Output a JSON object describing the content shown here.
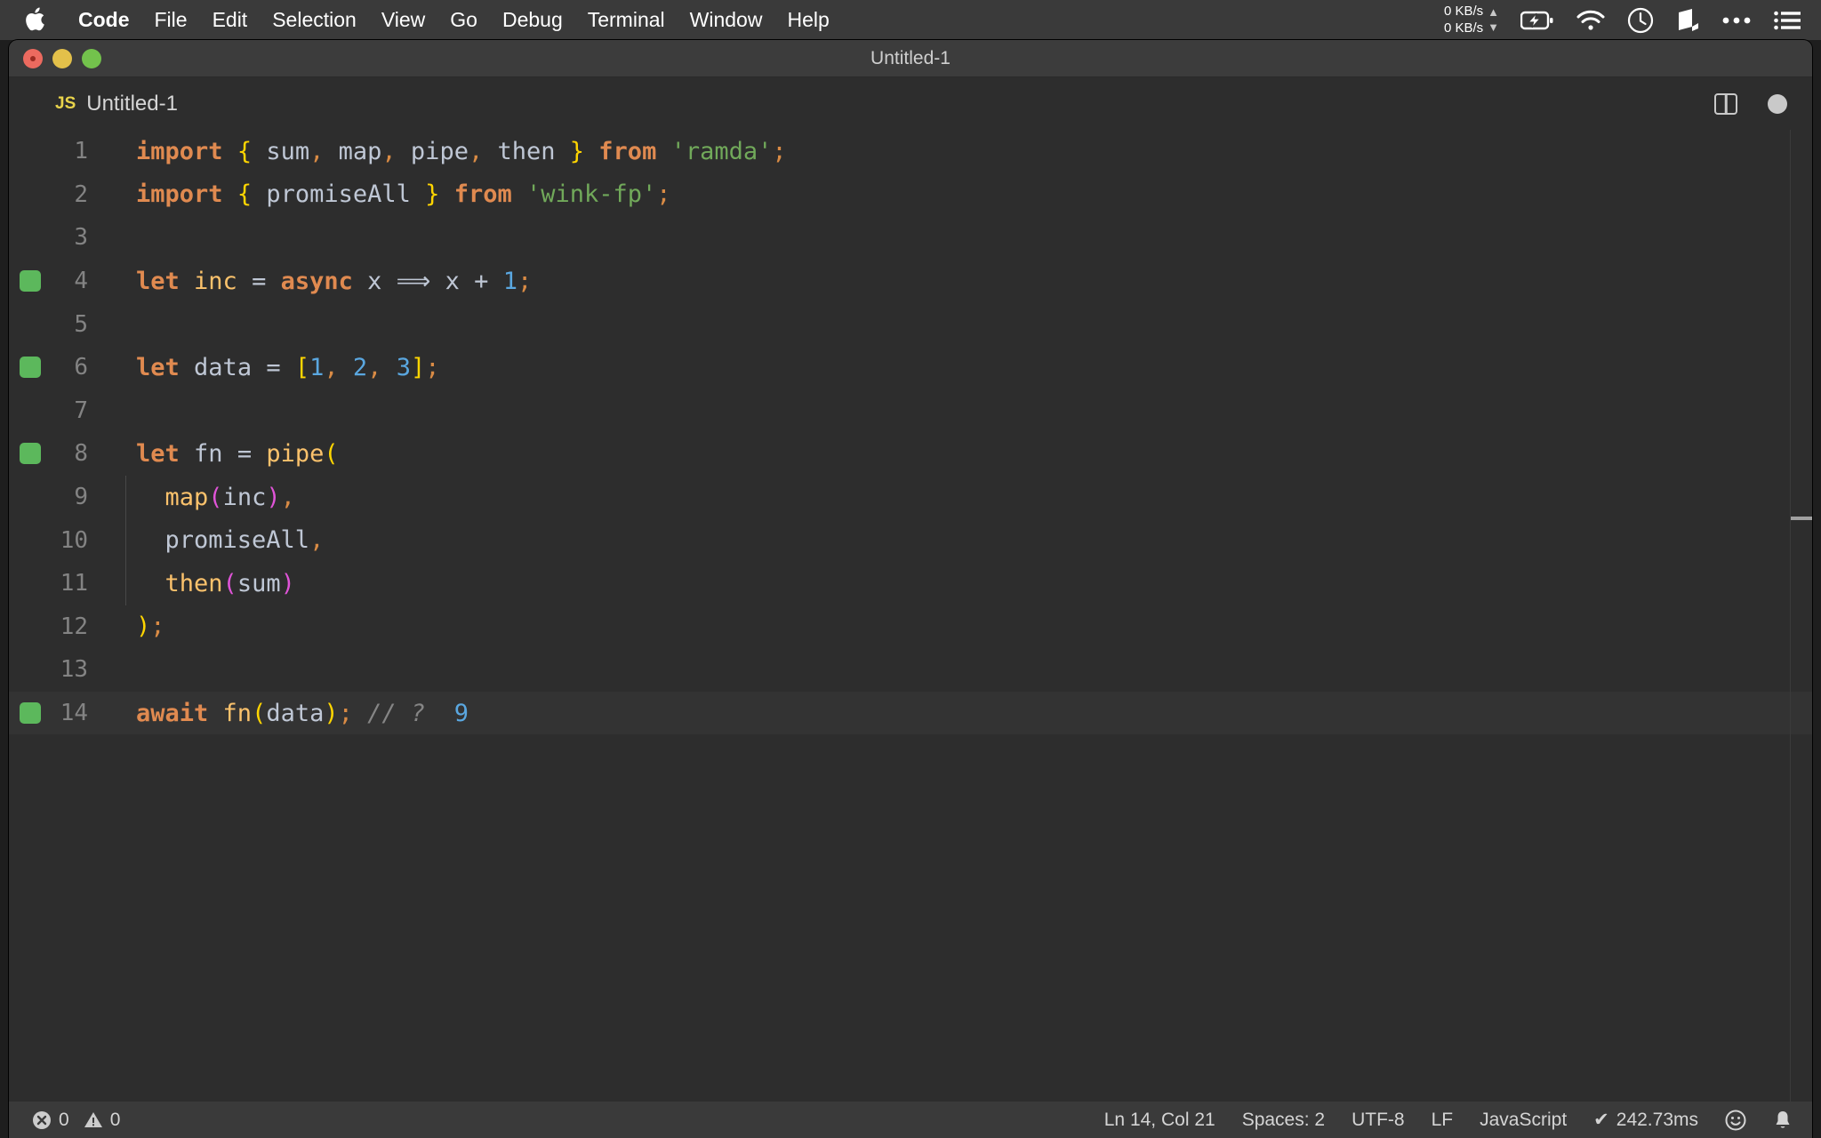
{
  "menubar": {
    "apple_icon": "apple-logo-icon",
    "items": [
      {
        "label": "Code",
        "bold": true
      },
      {
        "label": "File",
        "bold": false
      },
      {
        "label": "Edit",
        "bold": false
      },
      {
        "label": "Selection",
        "bold": false
      },
      {
        "label": "View",
        "bold": false
      },
      {
        "label": "Go",
        "bold": false
      },
      {
        "label": "Debug",
        "bold": false
      },
      {
        "label": "Terminal",
        "bold": false
      },
      {
        "label": "Window",
        "bold": false
      },
      {
        "label": "Help",
        "bold": false
      }
    ],
    "tray": {
      "net_up": "0 KB/s",
      "net_down": "0 KB/s",
      "up_arrow": "▲",
      "down_arrow": "▼",
      "icons": [
        "battery-charging-icon",
        "wifi-icon",
        "clock-icon",
        "cube-icon",
        "ellipsis-icon",
        "control-center-list-icon"
      ]
    }
  },
  "window": {
    "title": "Untitled-1",
    "traffic_lights": [
      "close-button",
      "minimize-button",
      "maximize-button"
    ]
  },
  "tab": {
    "file_type_badge": "JS",
    "label": "Untitled-1",
    "actions": [
      "split-editor-icon",
      "unsaved-dot-icon"
    ]
  },
  "editor": {
    "language": "JavaScript",
    "lines": [
      {
        "n": "1",
        "mark": false,
        "active": false,
        "indent_guide": false
      },
      {
        "n": "2",
        "mark": false,
        "active": false,
        "indent_guide": false
      },
      {
        "n": "3",
        "mark": false,
        "active": false,
        "indent_guide": false
      },
      {
        "n": "4",
        "mark": true,
        "active": false,
        "indent_guide": false
      },
      {
        "n": "5",
        "mark": false,
        "active": false,
        "indent_guide": false
      },
      {
        "n": "6",
        "mark": true,
        "active": false,
        "indent_guide": false
      },
      {
        "n": "7",
        "mark": false,
        "active": false,
        "indent_guide": false
      },
      {
        "n": "8",
        "mark": true,
        "active": false,
        "indent_guide": false
      },
      {
        "n": "9",
        "mark": false,
        "active": false,
        "indent_guide": true
      },
      {
        "n": "10",
        "mark": false,
        "active": false,
        "indent_guide": true
      },
      {
        "n": "11",
        "mark": false,
        "active": false,
        "indent_guide": true
      },
      {
        "n": "12",
        "mark": false,
        "active": false,
        "indent_guide": false
      },
      {
        "n": "13",
        "mark": false,
        "active": false,
        "indent_guide": false
      },
      {
        "n": "14",
        "mark": true,
        "active": true,
        "indent_guide": false
      }
    ],
    "source_text": [
      "import { sum, map, pipe, then } from 'ramda';",
      "import { promiseAll } from 'wink-fp';",
      "",
      "let inc = async x ⟹ x + 1;",
      "",
      "let data = [1, 2, 3];",
      "",
      "let fn = pipe(",
      "  map(inc),",
      "  promiseAll,",
      "  then(sum)",
      ");",
      "",
      "await fn(data); // ?  9"
    ],
    "inline_result": "9"
  },
  "status_bar": {
    "errors": "0",
    "warnings": "0",
    "position": "Ln 14, Col 21",
    "indentation": "Spaces: 2",
    "encoding": "UTF-8",
    "eol": "LF",
    "language_mode": "JavaScript",
    "run_time": "242.73ms",
    "run_check": "✔",
    "feedback_icon": "smiley-icon",
    "notifications_icon": "bell-icon"
  },
  "colors": {
    "editor_bg": "#2d2d2d",
    "titlebar_bg": "#3c3c3c",
    "statusbar_bg": "#3a3a3a",
    "keyword": "#e08a50",
    "function": "#fbc26c",
    "string": "#71a95a",
    "number": "#5aa7e0",
    "bracket_yellow": "#ffd500",
    "bracket_magenta": "#e054d8",
    "comment": "#858585",
    "git_added": "#5cb85c"
  }
}
